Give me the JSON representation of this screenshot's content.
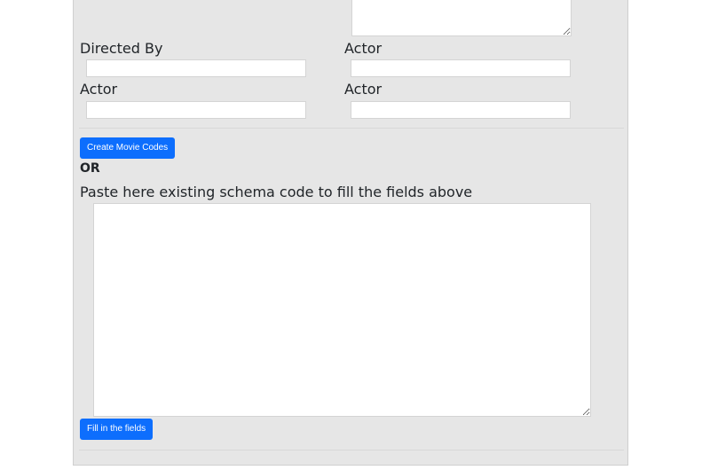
{
  "form": {
    "directed_by_label": "Directed By",
    "actor_label_1": "Actor",
    "actor_label_2": "Actor",
    "actor_label_3": "Actor",
    "directed_by_value": "",
    "actor_value_1": "",
    "actor_value_2": "",
    "actor_value_3": ""
  },
  "actions": {
    "create_button": "Create Movie Codes",
    "or_text": "OR",
    "paste_label": "Paste here existing schema code to fill the fields above",
    "schema_value": "",
    "fill_button": "Fill in the fields"
  },
  "colors": {
    "panel_bg": "#e6e6e6",
    "button_bg": "#0d6efd",
    "button_text": "#ffffff"
  }
}
